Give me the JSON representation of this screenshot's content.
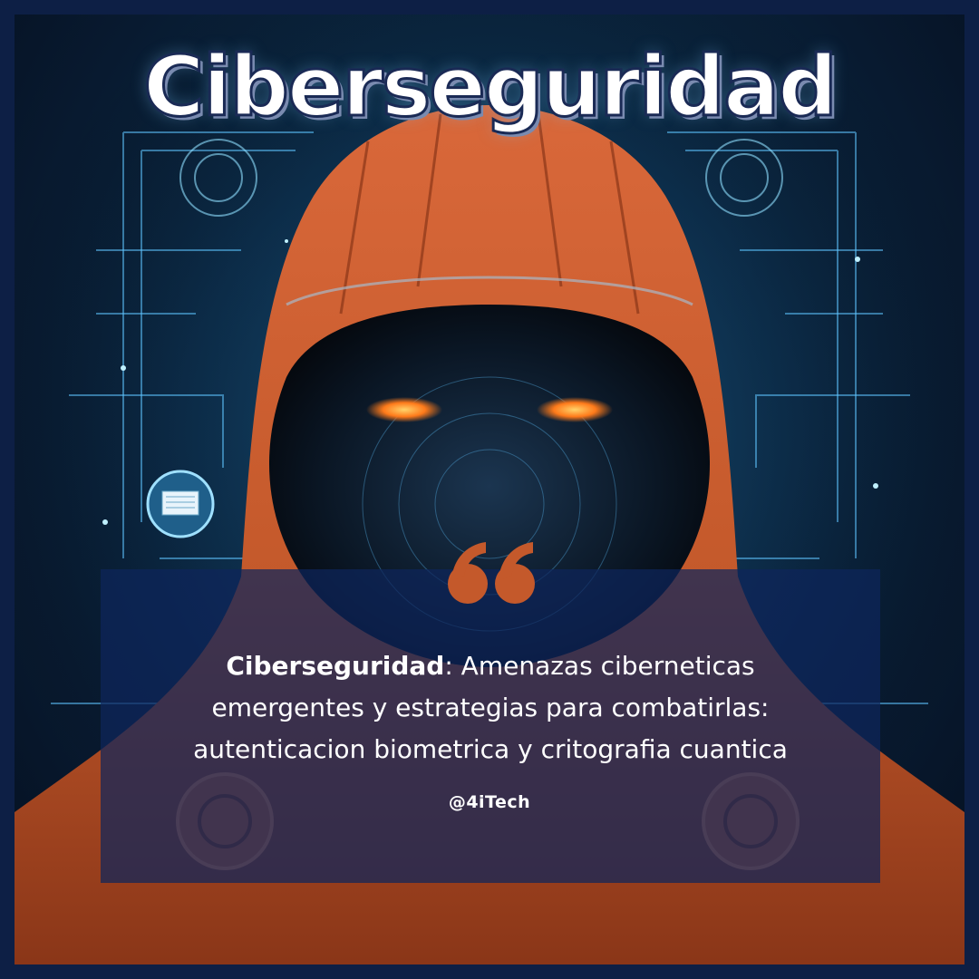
{
  "title": "Ciberseguridad",
  "quote": {
    "bold_lead": "Ciberseguridad",
    "rest_line1": ": Amenazas ciberneticas",
    "line2": "emergentes y estrategias para combatirlas:",
    "line3": "autenticacion biometrica y critografia cuantica"
  },
  "handle": "@4iTech",
  "colors": {
    "frame": "#0d1f45",
    "hood": "#c4592b",
    "panel": "#0e265c",
    "quote_mark": "#c4592b",
    "eyes": "#ff7a1a",
    "circuit": "#5fc4ff"
  },
  "icons": [
    "hooded-figure-illustration",
    "quote-mark-icon",
    "laptop-badge-icon"
  ]
}
